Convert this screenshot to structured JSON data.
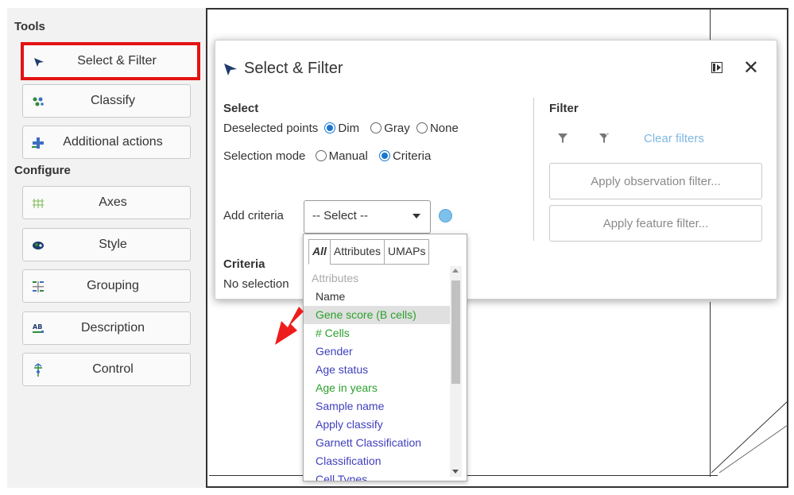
{
  "sidebar": {
    "tools_title": "Tools",
    "configure_title": "Configure",
    "tools": [
      {
        "label": "Select & Filter",
        "icon": "cursor-arrow-icon",
        "selected": true
      },
      {
        "label": "Classify",
        "icon": "classify-icon"
      },
      {
        "label": "Additional actions",
        "icon": "plus-icon"
      }
    ],
    "configure": [
      {
        "label": "Axes",
        "icon": "axes-grid-icon"
      },
      {
        "label": "Style",
        "icon": "style-icon"
      },
      {
        "label": "Grouping",
        "icon": "grouping-icon"
      },
      {
        "label": "Description",
        "icon": "description-icon"
      },
      {
        "label": "Control",
        "icon": "control-icon"
      }
    ]
  },
  "dialog": {
    "title": "Select & Filter",
    "select": {
      "title": "Select",
      "deselected_label": "Deselected points",
      "deselected_options": [
        "Dim",
        "Gray",
        "None"
      ],
      "deselected_value": "Dim",
      "mode_label": "Selection mode",
      "mode_options": [
        "Manual",
        "Criteria"
      ],
      "mode_value": "Criteria",
      "add_criteria_label": "Add criteria",
      "select_value": "-- Select --",
      "criteria_title": "Criteria",
      "criteria_empty": "No selection"
    },
    "filter": {
      "title": "Filter",
      "clear_filters": "Clear filters",
      "observation_button": "Apply observation filter...",
      "feature_button": "Apply feature filter..."
    }
  },
  "dropdown": {
    "tabs": [
      "All",
      "Attributes",
      "UMAPs"
    ],
    "active_tab": "All",
    "header": "Attributes",
    "items": [
      {
        "label": "Name",
        "color": "#333333"
      },
      {
        "label": "Gene score (B cells)",
        "color": "#2ca02c",
        "highlighted": true
      },
      {
        "label": "# Cells",
        "color": "#2ca02c"
      },
      {
        "label": "Gender",
        "color": "#3f3fbf"
      },
      {
        "label": "Age status",
        "color": "#3f3fbf"
      },
      {
        "label": "Age in years",
        "color": "#2ca02c"
      },
      {
        "label": "Sample name",
        "color": "#3f3fbf"
      },
      {
        "label": "Apply classify",
        "color": "#3f3fbf"
      },
      {
        "label": "Garnett Classification",
        "color": "#3f3fbf"
      },
      {
        "label": "Classification",
        "color": "#3f3fbf"
      },
      {
        "label": "Cell Types",
        "color": "#3f3fbf"
      }
    ]
  },
  "colors": {
    "accent": "#1976d2",
    "highlight_red": "#e41313",
    "link_light_blue": "#7fb8e0"
  }
}
